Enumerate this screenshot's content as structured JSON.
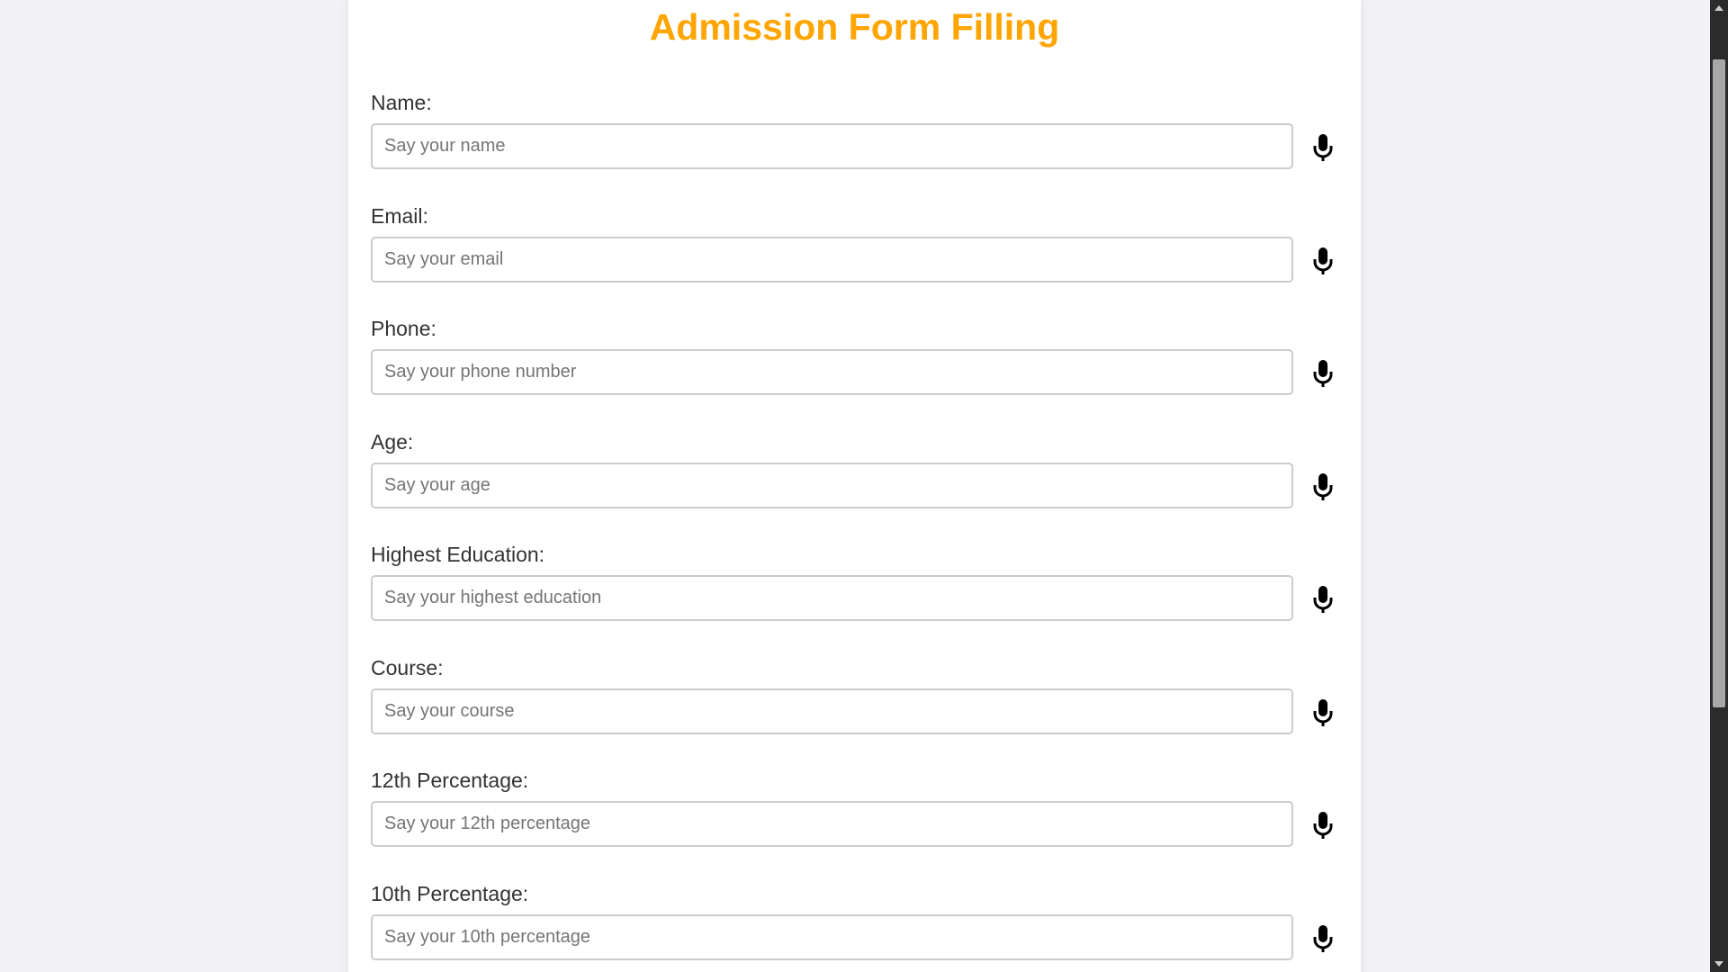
{
  "page": {
    "title": "Admission Form Filling",
    "accent_color": "#ffa500"
  },
  "fields": [
    {
      "label": "Name:",
      "placeholder": "Say your name",
      "value": "",
      "mic_icon": "microphone-icon"
    },
    {
      "label": "Email:",
      "placeholder": "Say your email",
      "value": "",
      "mic_icon": "microphone-icon"
    },
    {
      "label": "Phone:",
      "placeholder": "Say your phone number",
      "value": "",
      "mic_icon": "microphone-icon"
    },
    {
      "label": "Age:",
      "placeholder": "Say your age",
      "value": "",
      "mic_icon": "microphone-icon"
    },
    {
      "label": "Highest Education:",
      "placeholder": "Say your highest education",
      "value": "",
      "mic_icon": "microphone-icon"
    },
    {
      "label": "Course:",
      "placeholder": "Say your course",
      "value": "",
      "mic_icon": "microphone-icon"
    },
    {
      "label": "12th Percentage:",
      "placeholder": "Say your 12th percentage",
      "value": "",
      "mic_icon": "microphone-icon"
    },
    {
      "label": "10th Percentage:",
      "placeholder": "Say your 10th percentage",
      "value": "",
      "mic_icon": "microphone-icon"
    }
  ],
  "scrollbar": {
    "up_icon": "scroll-up-arrow-icon",
    "down_icon": "scroll-down-arrow-icon"
  }
}
